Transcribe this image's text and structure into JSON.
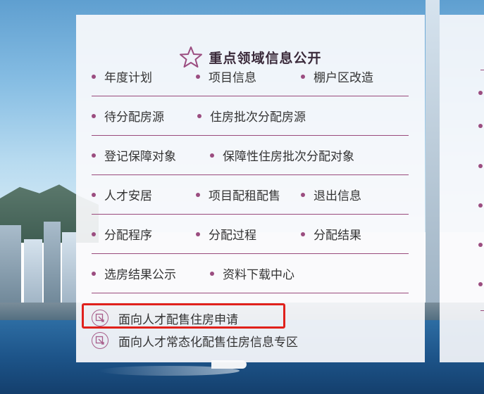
{
  "section": {
    "title": "重点领域信息公开",
    "star_icon": "star-outline-icon"
  },
  "rows": [
    {
      "items": [
        "年度计划",
        "项目信息",
        "棚户区改造"
      ]
    },
    {
      "items": [
        "待分配房源",
        "住房批次分配房源"
      ]
    },
    {
      "items": [
        "登记保障对象",
        "保障性住房批次分配对象"
      ]
    },
    {
      "items": [
        "人才安居",
        "项目配租配售",
        "退出信息"
      ]
    },
    {
      "items": [
        "分配程序",
        "分配过程",
        "分配结果"
      ]
    },
    {
      "items": [
        "选房结果公示",
        "资料下载中心"
      ]
    }
  ],
  "features": [
    {
      "label": "面向人才配售住房申请",
      "icon": "external-link-icon",
      "highlighted": true
    },
    {
      "label": "面向人才常态化配售住房信息专区",
      "icon": "external-link-icon",
      "highlighted": false
    }
  ],
  "colors": {
    "accent": "#9b4d80",
    "highlight": "#e0211c",
    "text": "#333333"
  }
}
